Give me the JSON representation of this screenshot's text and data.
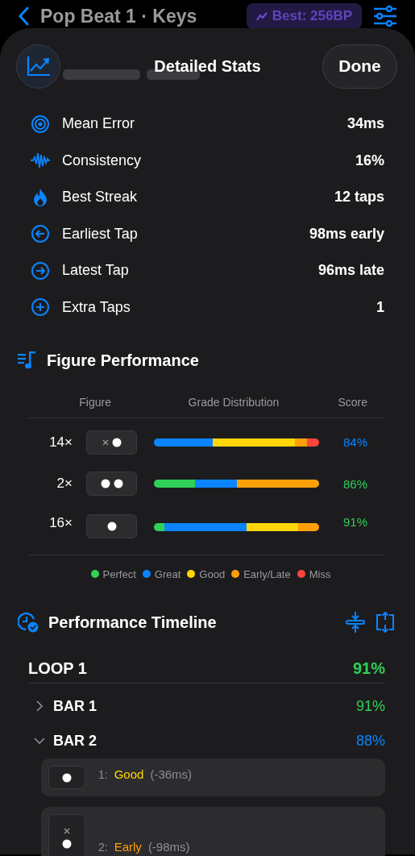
{
  "background_screen": {
    "title": "Pop Beat 1 · Keys",
    "best_badge": "Best: 256BP"
  },
  "sheet": {
    "title": "Detailed Stats",
    "done_button": "Done"
  },
  "stats": [
    {
      "label": "Mean Error",
      "value": "34ms"
    },
    {
      "label": "Consistency",
      "value": "16%"
    },
    {
      "label": "Best Streak",
      "value": "12 taps"
    },
    {
      "label": "Earliest Tap",
      "value": "98ms early"
    },
    {
      "label": "Latest Tap",
      "value": "96ms late"
    },
    {
      "label": "Extra Taps",
      "value": "1"
    }
  ],
  "figure_performance": {
    "title": "Figure Performance",
    "columns": [
      "Figure",
      "Grade Distribution",
      "Score"
    ],
    "rows": [
      {
        "count": "14×",
        "figure": [
          {
            "kind": "rest"
          },
          {
            "kind": "note"
          }
        ],
        "segments": [
          {
            "color": "#0a84ff"
          },
          {
            "color": "#ffd60a"
          },
          {
            "color": "#ff9f0a"
          },
          {
            "color": "#ff453a"
          }
        ],
        "score": "84%",
        "color": "#0a84ff"
      },
      {
        "count": "2×",
        "figure": [
          {
            "kind": "note"
          },
          {
            "kind": "note"
          }
        ],
        "segments": [
          {
            "color": "#30d158"
          },
          {
            "color": "#0a84ff"
          },
          {
            "color": "#ff9f0a"
          }
        ],
        "score": "86%",
        "color": "#30d158"
      },
      {
        "count": "16×",
        "figure": [
          {
            "kind": "note"
          }
        ],
        "segments": [
          {
            "color": "#30d158"
          },
          {
            "color": "#0a84ff"
          },
          {
            "color": "#ffd60a"
          },
          {
            "color": "#ff9f0a"
          }
        ],
        "score": "91%",
        "color": "#30d158"
      }
    ],
    "legend": [
      {
        "label": "Perfect",
        "color": "#30d158"
      },
      {
        "label": "Great",
        "color": "#0a84ff"
      },
      {
        "label": "Good",
        "color": "#ffd60a"
      },
      {
        "label": "Early/Late",
        "color": "#ff9f0a"
      },
      {
        "label": "Miss",
        "color": "#ff453a"
      }
    ]
  },
  "timeline": {
    "title": "Performance Timeline",
    "loops": [
      {
        "label": "LOOP 1",
        "score": "91%",
        "color": "#30d158",
        "children": [
          {
            "label": "BAR 1",
            "score": "91%",
            "color": "#30d158",
            "expanded": false
          },
          {
            "label": "BAR 2",
            "score": "88%",
            "color": "#0a84ff",
            "expanded": true,
            "children": [
              {
                "number": "1:",
                "grade": "Good",
                "detail": "(-36ms)",
                "color": "#ffd60a",
                "figure": [
                  {
                    "kind": "note"
                  }
                ]
              },
              {
                "number": "2:",
                "grade": "Early",
                "detail": "(-98ms)",
                "color": "#ff9f0a",
                "figure": [
                  {
                    "kind": "rest"
                  },
                  {
                    "kind": "note"
                  }
                ]
              }
            ]
          }
        ]
      }
    ]
  }
}
